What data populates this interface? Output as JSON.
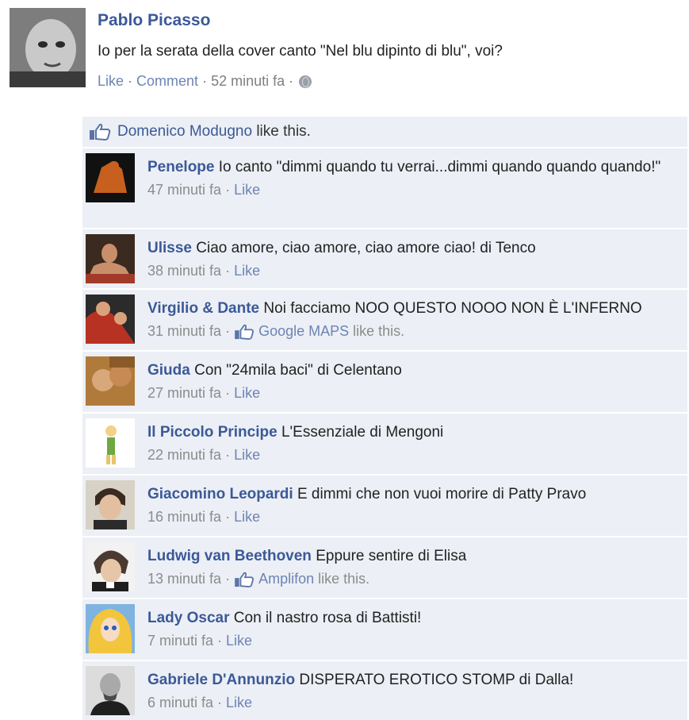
{
  "post": {
    "author": "Pablo Picasso",
    "text": "Io per la serata della cover canto \"Nel blu dipinto di blu\", voi?",
    "like_label": "Like",
    "comment_label": "Comment",
    "time": "52 minuti fa",
    "sep": "·",
    "privacy_icon": "globe-icon"
  },
  "likes": {
    "name": "Domenico Modugno",
    "suffix": "like this."
  },
  "comments": [
    {
      "name": "Penelope",
      "text": "Io canto \"dimmi quando tu verrai...dimmi quando quando quando!\"",
      "time": "47 minuti fa",
      "like": "Like",
      "avatar_color": "#b8541d"
    },
    {
      "name": "Ulisse",
      "text": "Ciao amore, ciao amore, ciao amore ciao! di Tenco",
      "time": "38 minuti fa",
      "like": "Like",
      "avatar_color": "#9a4b2f"
    },
    {
      "name": "Virgilio & Dante",
      "text": "Noi facciamo NOO QUESTO NOOO NON È L'INFERNO",
      "time": "31 minuti fa",
      "liker": "Google MAPS",
      "liker_suffix": "like this.",
      "avatar_color": "#c0392b"
    },
    {
      "name": "Giuda",
      "text": "Con \"24mila baci\" di Celentano",
      "time": "27 minuti fa",
      "like": "Like",
      "avatar_color": "#b07a3a"
    },
    {
      "name": "Il Piccolo Principe",
      "text": "L'Essenziale di Mengoni",
      "time": "22 minuti fa",
      "like": "Like",
      "avatar_color": "#f4f1d0"
    },
    {
      "name": "Giacomino Leopardi",
      "text": "E dimmi che non vuoi morire di Patty Pravo",
      "time": "16 minuti fa",
      "like": "Like",
      "avatar_color": "#5c4a3a"
    },
    {
      "name": "Ludwig van Beethoven",
      "text": "Eppure sentire di Elisa",
      "time": "13 minuti fa",
      "liker": "Amplifon",
      "liker_suffix": "like this.",
      "avatar_color": "#4a3a2f"
    },
    {
      "name": "Lady Oscar",
      "text": "Con il nastro rosa di Battisti!",
      "time": "7 minuti fa",
      "like": "Like",
      "avatar_color": "#f2c53d"
    },
    {
      "name": "Gabriele D'Annunzio",
      "text": "DISPERATO EROTICO STOMP di Dalla!",
      "time": "6 minuti fa",
      "like": "Like",
      "avatar_color": "#6b6b6b"
    }
  ],
  "colors": {
    "link": "#3b5998",
    "muted_link": "#6d84b4",
    "feed_bg": "#eceff5"
  }
}
